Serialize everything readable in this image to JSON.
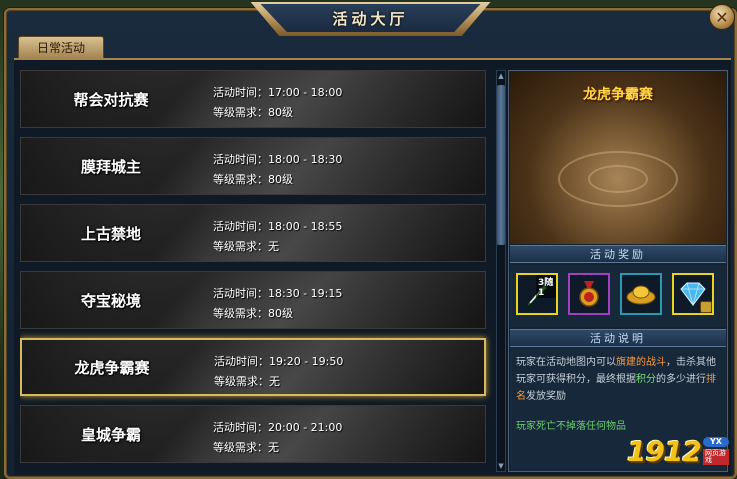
{
  "window": {
    "title": "活动大厅",
    "close_label": "✕"
  },
  "tabs": [
    {
      "label": "日常活动",
      "active": true
    }
  ],
  "labels": {
    "time_prefix": "活动时间：",
    "level_prefix": "等级需求："
  },
  "activities": [
    {
      "name": "帮会对抗赛",
      "time": "17:00 - 18:00",
      "level": "80级"
    },
    {
      "name": "膜拜城主",
      "time": "18:00 - 18:30",
      "level": "80级"
    },
    {
      "name": "上古禁地",
      "time": "18:00 - 18:55",
      "level": "无"
    },
    {
      "name": "夺宝秘境",
      "time": "18:30 - 19:15",
      "level": "80级"
    },
    {
      "name": "龙虎争霸赛",
      "time": "19:20 - 19:50",
      "level": "无",
      "selected": true
    },
    {
      "name": "皇城争霸",
      "time": "20:00 - 21:00",
      "level": "无"
    }
  ],
  "detail": {
    "title": "龙虎争霸赛",
    "rewards_header": "活动奖励",
    "rewards": [
      {
        "icon": "green-feather-icon",
        "badge": "3随1",
        "border": "#e6d420"
      },
      {
        "icon": "red-medal-icon",
        "badge": "",
        "border": "#a040c0"
      },
      {
        "icon": "gold-ingot-icon",
        "badge": "",
        "border": "#2a9ab0"
      },
      {
        "icon": "blue-diamond-icon",
        "badge": "",
        "border": "#e6d420",
        "locked": true
      }
    ],
    "desc_header": "活动说明",
    "desc_parts": {
      "p1": "玩家在活动地图内可以",
      "h1": "旗建的战斗",
      "p2": "，击杀其他玩家可获得积分，最终根据",
      "h2": "积分",
      "p3": "的多少进行",
      "h3": "排名",
      "p4": "发放奖励"
    },
    "note": "玩家死亡不掉落任何物品"
  },
  "watermark": {
    "number": "1912",
    "badge": "YX",
    "sub": "网页游戏"
  },
  "colors": {
    "accent_gold": "#d9b960",
    "title_yellow": "#ffd84a",
    "highlight_orange": "#ff9a3a",
    "highlight_green": "#7ae07a"
  }
}
